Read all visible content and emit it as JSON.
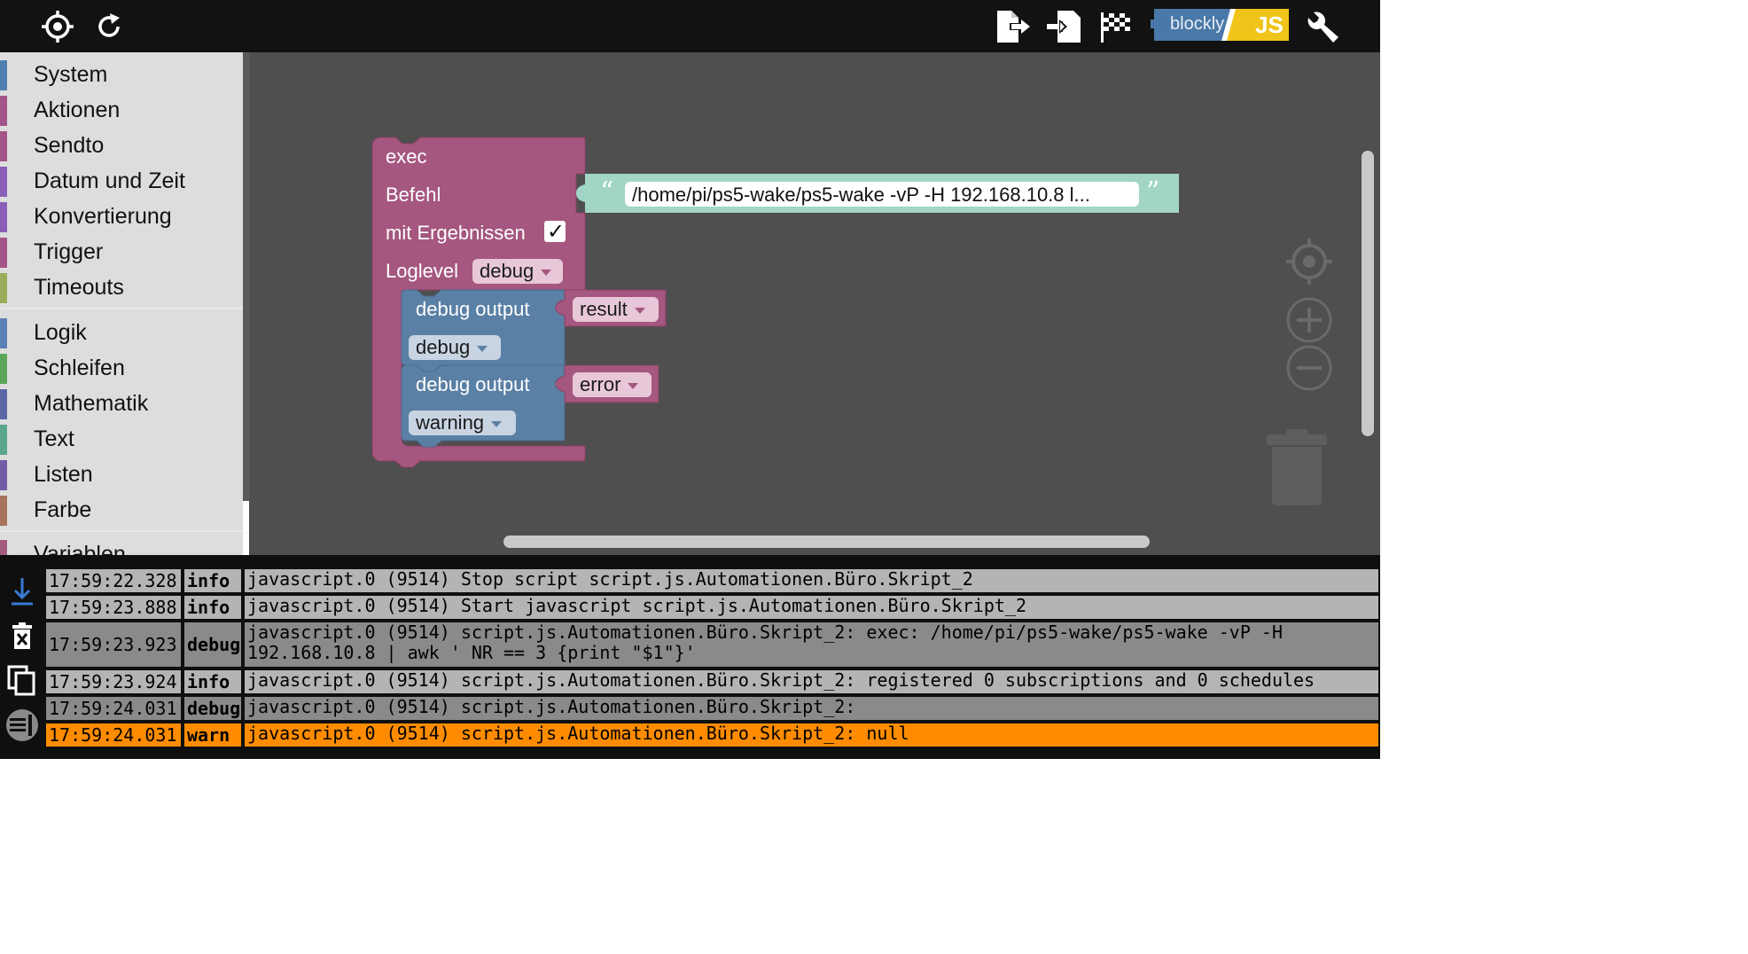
{
  "toolbar": {
    "left_icons": [
      "crosshair-icon",
      "refresh-icon"
    ],
    "right_icons": [
      "export-icon",
      "import-icon",
      "checkered-flag-icon",
      "blockly-js-logo",
      "wrench-icon"
    ],
    "logo_text": "blockly",
    "logo_suffix": "JS"
  },
  "sidebar": {
    "groups": [
      [
        {
          "label": "System",
          "color": "#4f7fb0"
        },
        {
          "label": "Aktionen",
          "color": "#a5548a"
        },
        {
          "label": "Sendto",
          "color": "#a5548a"
        },
        {
          "label": "Datum und Zeit",
          "color": "#8a5fb8"
        },
        {
          "label": "Konvertierung",
          "color": "#8a5fb8"
        },
        {
          "label": "Trigger",
          "color": "#a5548a"
        },
        {
          "label": "Timeouts",
          "color": "#9aad5a"
        }
      ],
      [
        {
          "label": "Logik",
          "color": "#5b80b5"
        },
        {
          "label": "Schleifen",
          "color": "#5ba55b"
        },
        {
          "label": "Mathematik",
          "color": "#5b67a5"
        },
        {
          "label": "Text",
          "color": "#5ba58c"
        },
        {
          "label": "Listen",
          "color": "#745ba5"
        },
        {
          "label": "Farbe",
          "color": "#a5745b"
        }
      ],
      [
        {
          "label": "Variablen",
          "color": "#a55b80"
        }
      ]
    ]
  },
  "blocks": {
    "exec": {
      "title": "exec",
      "command_label": "Befehl",
      "command_value": "/home/pi/ps5-wake/ps5-wake -vP -H 192.168.10.8 l...",
      "results_label": "mit Ergebnissen",
      "results_checked": "✓",
      "loglevel_label": "Loglevel",
      "loglevel_value": "debug",
      "color": "#a5577f"
    },
    "debug1": {
      "label": "debug output",
      "value": "result",
      "level": "debug",
      "color": "#5b80a5"
    },
    "debug2": {
      "label": "debug output",
      "value": "error",
      "level": "warning",
      "color": "#5b80a5"
    }
  },
  "log": {
    "tools": [
      "scroll-down-icon",
      "clear-log-icon",
      "copy-icon",
      "toggle-log-icon"
    ],
    "rows": [
      {
        "time": "17:59:22.328",
        "level": "info",
        "message": "javascript.0 (9514) Stop script script.js.Automationen.Büro.Skript_2"
      },
      {
        "time": "17:59:23.888",
        "level": "info",
        "message": "javascript.0 (9514) Start javascript script.js.Automationen.Büro.Skript_2"
      },
      {
        "time": "17:59:23.923",
        "level": "debug",
        "message": "javascript.0 (9514) script.js.Automationen.Büro.Skript_2: exec: /home/pi/ps5-wake/ps5-wake -vP -H\n192.168.10.8 | awk ' NR == 3 {print \"$1\"}'"
      },
      {
        "time": "17:59:23.924",
        "level": "info",
        "message": "javascript.0 (9514) script.js.Automationen.Büro.Skript_2: registered 0 subscriptions and 0 schedules"
      },
      {
        "time": "17:59:24.031",
        "level": "debug",
        "message": "javascript.0 (9514) script.js.Automationen.Büro.Skript_2:"
      },
      {
        "time": "17:59:24.031",
        "level": "warn",
        "message": "javascript.0 (9514) script.js.Automationen.Büro.Skript_2: null"
      }
    ],
    "colors": {
      "info": "#b4b4b4",
      "debug": "#8a8a8a",
      "warn": "#ff8c00"
    }
  }
}
